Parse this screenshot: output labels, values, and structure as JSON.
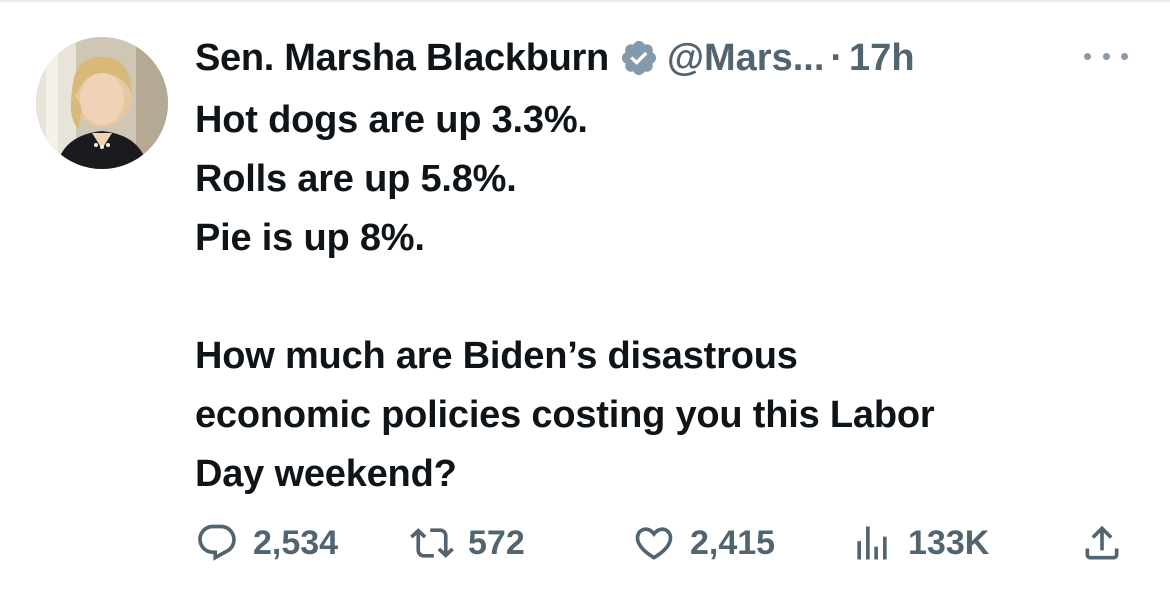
{
  "tweet": {
    "author": {
      "display_name": "Sen. Marsha Blackburn",
      "handle": "@Mars...",
      "verified_icon": "verified-badge-icon"
    },
    "separator": "·",
    "timestamp": "17h",
    "text_lines": [
      "Hot dogs are up 3.3%.",
      "Rolls are up 5.8%.",
      "Pie is up 8%.",
      "",
      "How much are Biden’s disastrous",
      "economic policies costing you this Labor",
      "Day weekend?"
    ],
    "actions": {
      "reply": {
        "icon": "reply-icon",
        "count": "2,534"
      },
      "retweet": {
        "icon": "retweet-icon",
        "count": "572"
      },
      "like": {
        "icon": "heart-icon",
        "count": "2,415"
      },
      "views": {
        "icon": "views-icon",
        "count": "133K"
      },
      "share": {
        "icon": "share-icon"
      }
    }
  },
  "colors": {
    "text_primary": "#0f1419",
    "text_secondary": "#536471",
    "verified_badge": "#829aab",
    "divider": "#e6ecf0"
  }
}
